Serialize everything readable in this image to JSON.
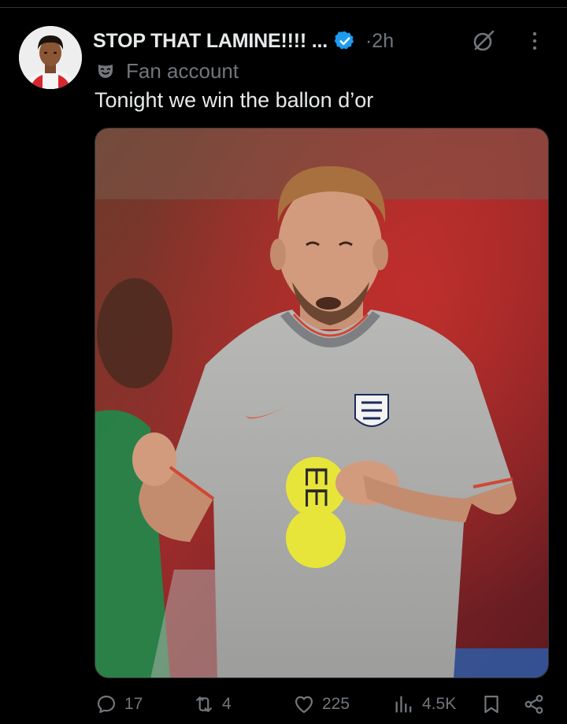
{
  "post": {
    "display_name": "STOP THAT LAMINE!!!! ...",
    "time": "·2h",
    "label": "Fan account",
    "text": "Tonight we win the ballon d’or"
  },
  "icons": {
    "verified": "verified-badge-icon",
    "grok": "grok-icon",
    "more": "more-icon",
    "label": "mask-icon",
    "reply": "reply-icon",
    "repost": "repost-icon",
    "like": "like-icon",
    "views": "views-icon",
    "bookmark": "bookmark-icon",
    "share": "share-icon"
  },
  "actions": {
    "replies": "17",
    "reposts": "4",
    "likes": "225",
    "views": "4.5K"
  },
  "colors": {
    "background": "#000000",
    "text_primary": "#e7e9ea",
    "text_secondary": "#71767b",
    "verified_blue": "#1d9bf0"
  }
}
